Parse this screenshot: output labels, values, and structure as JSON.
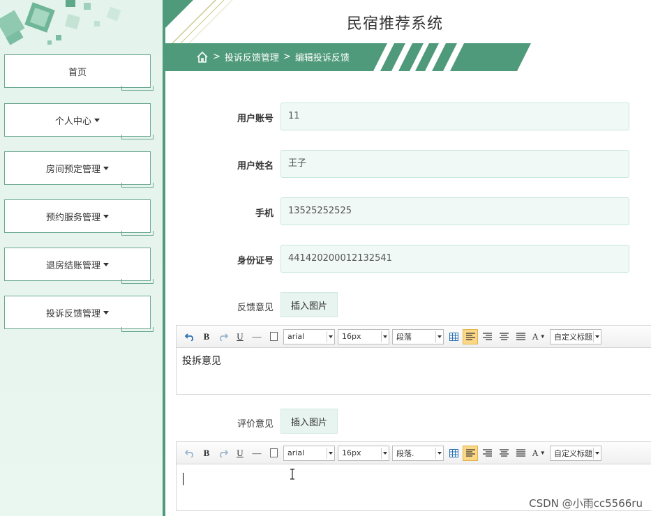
{
  "header": {
    "title": "民宿推荐系统"
  },
  "breadcrumb": {
    "sep1": ">",
    "item1": "投诉反馈管理",
    "sep2": ">",
    "item2": "编辑投诉反馈"
  },
  "sidebar": {
    "items": [
      {
        "label": "首页",
        "dropdown": false
      },
      {
        "label": "个人中心",
        "dropdown": true
      },
      {
        "label": "房间预定管理",
        "dropdown": true
      },
      {
        "label": "预约服务管理",
        "dropdown": true
      },
      {
        "label": "退房结账管理",
        "dropdown": true
      },
      {
        "label": "投诉反馈管理",
        "dropdown": true
      }
    ]
  },
  "form": {
    "account_label": "用户账号",
    "account_value": "11",
    "name_label": "用户姓名",
    "name_value": "王子",
    "phone_label": "手机",
    "phone_value": "13525252525",
    "id_label": "身份证号",
    "id_value": "441420200012132541",
    "feedback_label": "反馈意见",
    "feedback_insert": "插入图片",
    "review_label": "评价意见",
    "review_insert": "插入图片"
  },
  "editor1": {
    "font": "arial",
    "size": "16px",
    "block": "段落",
    "custom": "自定义标题",
    "content": "投拆意见"
  },
  "editor2": {
    "font": "arial",
    "size": "16px",
    "block": "段落.",
    "custom": "自定义标题",
    "content": ""
  },
  "toolbar_glyphs": {
    "bold": "B",
    "underline": "U",
    "hr": "—",
    "fontcolor": "A"
  },
  "colors": {
    "accent": "#4f9a7a",
    "sidebar_bg": "#e4f3ec",
    "input_bg": "#f0f9f6"
  },
  "watermark": "CSDN @小雨cc5566ru"
}
